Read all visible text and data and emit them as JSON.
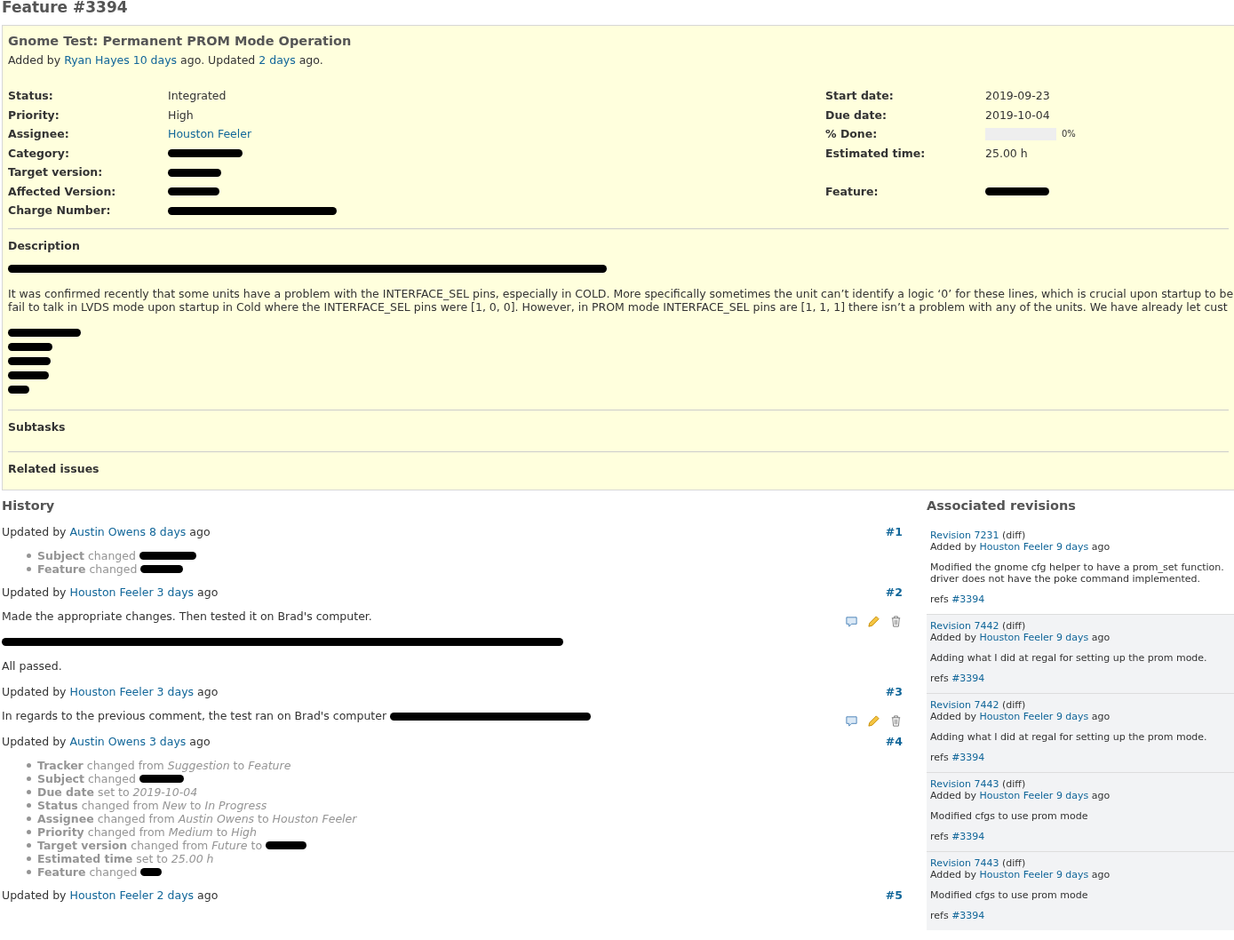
{
  "page_title": "Feature #3394",
  "issue": {
    "subject": "Gnome Test: Permanent PROM Mode Operation",
    "meta": [
      {
        "kind": "text",
        "text": "Added by"
      },
      {
        "kind": "link",
        "text": "Ryan Hayes"
      },
      {
        "kind": "link",
        "text": "10 days"
      },
      {
        "kind": "text",
        "text": "ago. Updated"
      },
      {
        "kind": "link",
        "text": "2 days"
      },
      {
        "kind": "text",
        "text": "ago."
      }
    ],
    "attribute_rows": [
      {
        "left": {
          "label": "Status:",
          "kind": "text",
          "value": "Integrated"
        },
        "right": {
          "label": "Start date:",
          "kind": "text",
          "value": "2019-09-23"
        }
      },
      {
        "left": {
          "label": "Priority:",
          "kind": "text",
          "value": "High"
        },
        "right": {
          "label": "Due date:",
          "kind": "text",
          "value": "2019-10-04"
        }
      },
      {
        "left": {
          "label": "Assignee:",
          "kind": "link",
          "value": "Houston Feeler"
        },
        "right": {
          "label": "% Done:",
          "kind": "progress",
          "level": 0,
          "value": "0%"
        }
      },
      {
        "left": {
          "label": "Category:",
          "kind": "redacted"
        },
        "right": {
          "label": "Estimated time:",
          "kind": "text",
          "value": "25.00 h"
        }
      },
      {
        "left": {
          "label": "Target version:",
          "kind": "redacted"
        }
      },
      {
        "left": {
          "label": "Affected Version:",
          "kind": "redacted"
        },
        "right": {
          "label": "Feature:",
          "kind": "redacted"
        }
      },
      {
        "left": {
          "label": "Charge Number:",
          "kind": "redacted"
        }
      }
    ],
    "description": {
      "heading": "Description",
      "blocks": [
        {
          "kind": "redacted"
        },
        {
          "kind": "text",
          "lines": [
            "It was confirmed recently that some units have a problem with the INTERFACE_SEL pins, especially in COLD. More specifically sometimes the unit can’t identify a logic ‘0’ for these lines, which is crucial upon startup to be",
            "fail to talk in LVDS mode upon startup in Cold where the INTERFACE_SEL pins were [1, 0, 0]. However, in PROM mode INTERFACE_SEL pins are [1, 1, 1] there isn’t a problem with any of the units. We have already let cust"
          ]
        },
        {
          "kind": "redacted_line"
        },
        {
          "kind": "redacted_line"
        },
        {
          "kind": "redacted_line"
        },
        {
          "kind": "redacted_line"
        },
        {
          "kind": "redacted_line"
        }
      ]
    },
    "sections": [
      "Subtasks",
      "Related issues"
    ]
  },
  "history": {
    "heading": "History",
    "journals": [
      {
        "header": [
          {
            "kind": "text",
            "text": "Updated by"
          },
          {
            "kind": "link",
            "text": "Austin Owens"
          },
          {
            "kind": "link",
            "text": "8 days"
          },
          {
            "kind": "text",
            "text": "ago"
          }
        ],
        "number": "#1",
        "details": [
          {
            "field": "Subject",
            "change": "changed",
            "redacted": true
          },
          {
            "field": "Feature",
            "change": "changed",
            "redacted": true
          }
        ]
      },
      {
        "header": [
          {
            "kind": "text",
            "text": "Updated by"
          },
          {
            "kind": "link",
            "text": "Houston Feeler"
          },
          {
            "kind": "link",
            "text": "3 days"
          },
          {
            "kind": "text",
            "text": "ago"
          }
        ],
        "number": "#2",
        "actions": true,
        "notes": [
          {
            "kind": "text",
            "text": "Made the appropriate changes. Then tested it on Brad's computer."
          },
          {
            "kind": "redacted"
          },
          {
            "kind": "text",
            "text": "All passed."
          }
        ]
      },
      {
        "header": [
          {
            "kind": "text",
            "text": "Updated by"
          },
          {
            "kind": "link",
            "text": "Houston Feeler"
          },
          {
            "kind": "link",
            "text": "3 days"
          },
          {
            "kind": "text",
            "text": "ago"
          }
        ],
        "number": "#3",
        "actions": true,
        "notes": [
          {
            "kind": "text_redacted",
            "text": "In regards to the previous comment, the test ran on Brad's computer"
          }
        ]
      },
      {
        "header": [
          {
            "kind": "text",
            "text": "Updated by"
          },
          {
            "kind": "link",
            "text": "Austin Owens"
          },
          {
            "kind": "link",
            "text": "3 days"
          },
          {
            "kind": "text",
            "text": "ago"
          }
        ],
        "number": "#4",
        "details": [
          {
            "field": "Tracker",
            "change": "changed from *Suggestion* to *Feature*",
            "redacted": false
          },
          {
            "field": "Subject",
            "change": "changed",
            "redacted": true
          },
          {
            "field": "Due date",
            "change": "set to *2019-10-04*",
            "redacted": false
          },
          {
            "field": "Status",
            "change": "changed from *New* to *In Progress*",
            "redacted": false
          },
          {
            "field": "Assignee",
            "change": "changed from *Austin Owens* to *Houston Feeler*",
            "redacted": false
          },
          {
            "field": "Priority",
            "change": "changed from *Medium* to *High*",
            "redacted": false
          },
          {
            "field": "Target version",
            "change": "changed from *Future* to",
            "redacted": true
          },
          {
            "field": "Estimated time",
            "change": "set to *25.00 h*",
            "redacted": false
          },
          {
            "field": "Feature",
            "change": "changed",
            "redacted": true
          }
        ]
      },
      {
        "header": [
          {
            "kind": "text",
            "text": "Updated by"
          },
          {
            "kind": "link",
            "text": "Houston Feeler"
          },
          {
            "kind": "link",
            "text": "2 days"
          },
          {
            "kind": "text",
            "text": "ago"
          }
        ],
        "number": "#5"
      }
    ]
  },
  "revisions": {
    "heading": "Associated revisions",
    "items": [
      {
        "title": "Revision 7231",
        "diff": "(diff)",
        "byline": [
          {
            "kind": "text",
            "text": "Added by"
          },
          {
            "kind": "link",
            "text": "Houston Feeler"
          },
          {
            "kind": "link",
            "text": "9 days"
          },
          {
            "kind": "text",
            "text": "ago"
          }
        ],
        "shaded": false,
        "message": [
          "Modified the gnome cfg helper to have a prom_set function.",
          "driver does not have the poke command implemented."
        ],
        "refs": [
          {
            "kind": "text",
            "text": "refs"
          },
          {
            "kind": "link",
            "text": "#3394"
          }
        ]
      },
      {
        "title": "Revision 7442",
        "diff": "(diff)",
        "byline": [
          {
            "kind": "text",
            "text": "Added by"
          },
          {
            "kind": "link",
            "text": "Houston Feeler"
          },
          {
            "kind": "link",
            "text": "9 days"
          },
          {
            "kind": "text",
            "text": "ago"
          }
        ],
        "shaded": true,
        "message": [
          "Adding what I did at regal for setting up the prom mode."
        ],
        "refs": [
          {
            "kind": "text",
            "text": "refs"
          },
          {
            "kind": "link",
            "text": "#3394"
          }
        ]
      },
      {
        "title": "Revision 7442",
        "diff": "(diff)",
        "byline": [
          {
            "kind": "text",
            "text": "Added by"
          },
          {
            "kind": "link",
            "text": "Houston Feeler"
          },
          {
            "kind": "link",
            "text": "9 days"
          },
          {
            "kind": "text",
            "text": "ago"
          }
        ],
        "shaded": true,
        "message": [
          "Adding what I did at regal for setting up the prom mode."
        ],
        "refs": [
          {
            "kind": "text",
            "text": "refs"
          },
          {
            "kind": "link",
            "text": "#3394"
          }
        ]
      },
      {
        "title": "Revision 7443",
        "diff": "(diff)",
        "byline": [
          {
            "kind": "text",
            "text": "Added by"
          },
          {
            "kind": "link",
            "text": "Houston Feeler"
          },
          {
            "kind": "link",
            "text": "9 days"
          },
          {
            "kind": "text",
            "text": "ago"
          }
        ],
        "shaded": true,
        "message": [
          "Modified cfgs to use prom mode"
        ],
        "refs": [
          {
            "kind": "text",
            "text": "refs"
          },
          {
            "kind": "link",
            "text": "#3394"
          }
        ]
      },
      {
        "title": "Revision 7443",
        "diff": "(diff)",
        "byline": [
          {
            "kind": "text",
            "text": "Added by"
          },
          {
            "kind": "link",
            "text": "Houston Feeler"
          },
          {
            "kind": "link",
            "text": "9 days"
          },
          {
            "kind": "text",
            "text": "ago"
          }
        ],
        "shaded": true,
        "message": [
          "Modified cfgs to use prom mode"
        ],
        "refs": [
          {
            "kind": "text",
            "text": "refs"
          },
          {
            "kind": "link",
            "text": "#3394"
          }
        ]
      }
    ]
  }
}
